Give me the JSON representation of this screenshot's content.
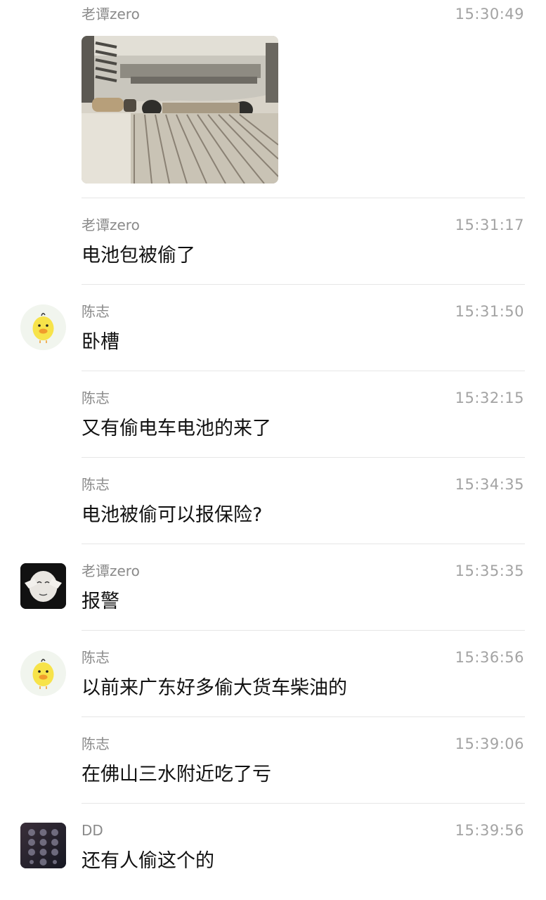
{
  "messages": [
    {
      "sender": "老谭zero",
      "time": "15:30:49",
      "type": "image",
      "image": "car-underside-photo"
    },
    {
      "sender": "老谭zero",
      "time": "15:31:17",
      "text": "电池包被偷了"
    },
    {
      "sender": "陈志",
      "time": "15:31:50",
      "text": "卧槽",
      "avatar": "duck-avatar"
    },
    {
      "sender": "陈志",
      "time": "15:32:15",
      "text": "又有偷电车电池的来了"
    },
    {
      "sender": "陈志",
      "time": "15:34:35",
      "text": "电池被偷可以报保险?"
    },
    {
      "sender": "老谭zero",
      "time": "15:35:35",
      "text": "报警",
      "avatar": "face-avatar"
    },
    {
      "sender": "陈志",
      "time": "15:36:56",
      "text": "以前来广东好多偷大货车柴油的",
      "avatar": "duck-avatar"
    },
    {
      "sender": "陈志",
      "time": "15:39:06",
      "text": "在佛山三水附近吃了亏"
    },
    {
      "sender": "DD",
      "time": "15:39:56",
      "text": "还有人偷这个的",
      "avatar": "keypad-avatar"
    }
  ],
  "colors": {
    "sender": "#8a8a8a",
    "time": "#a3a3a3",
    "text": "#111111",
    "divider": "#e6e6e6",
    "duck": "#f7e34a"
  }
}
